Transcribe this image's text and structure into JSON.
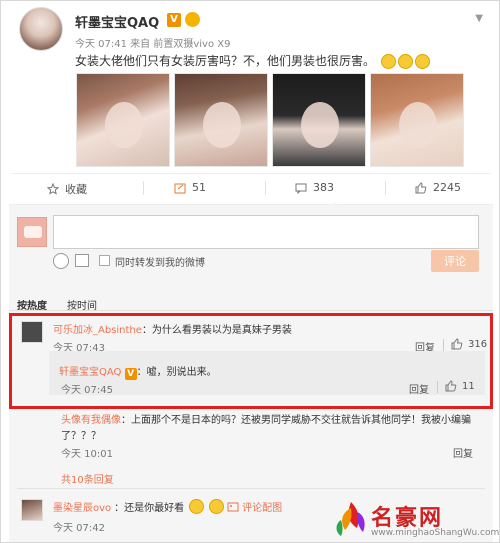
{
  "post": {
    "username": "轩墨宝宝QAQ",
    "verified_badge": "V",
    "meta": "今天 07:41 来自 前置双摄vivo X9",
    "text": "女装大佬他们只有女装厉害吗？不，他们男装也很厉害。",
    "photos": [
      "photo-1",
      "photo-2",
      "photo-3",
      "photo-4"
    ]
  },
  "actions": {
    "favorite": "收藏",
    "repost_count": "51",
    "comment_count": "383",
    "like_count": "2245"
  },
  "composer": {
    "input_value": "",
    "repost_label": "同时转发到我的微博",
    "submit_label": "评论"
  },
  "tabs": [
    {
      "label": "按热度",
      "active": true
    },
    {
      "label": "按时间",
      "active": false
    }
  ],
  "comments": [
    {
      "name": "可乐加冰_Absinthe",
      "text": "：为什么看男装以为是真妹子男装",
      "time": "今天 07:43",
      "reply_label": "回复",
      "likes": "316",
      "replies": [
        {
          "name": "轩墨宝宝QAQ",
          "badge": "V",
          "text": "：嘘，别说出来。",
          "time": "今天 07:45",
          "reply_label": "回复",
          "likes": "11"
        },
        {
          "name": "头像有我偶像",
          "text_line1": "：上面那个不是日本的吗？还被男同学威胁不交往就告诉其他同学！我被小编骗",
          "text_line2": "了？？？",
          "time": "今天 10:01",
          "reply_label": "回复"
        }
      ],
      "expand_label": "共10条回复"
    },
    {
      "name": "墨染星辰ovo",
      "text": "：还是你最好看",
      "report_label": "评论配图",
      "time": "今天 07:42"
    }
  ],
  "watermark": {
    "title": "名豪网",
    "url": "www.minghaoShangWu.com"
  },
  "colors": {
    "link_orange": "#eb7350",
    "highlight_red": "#e02020",
    "submit_disabled": "#f7c5a7",
    "panel_bg": "#f5f5f5"
  }
}
